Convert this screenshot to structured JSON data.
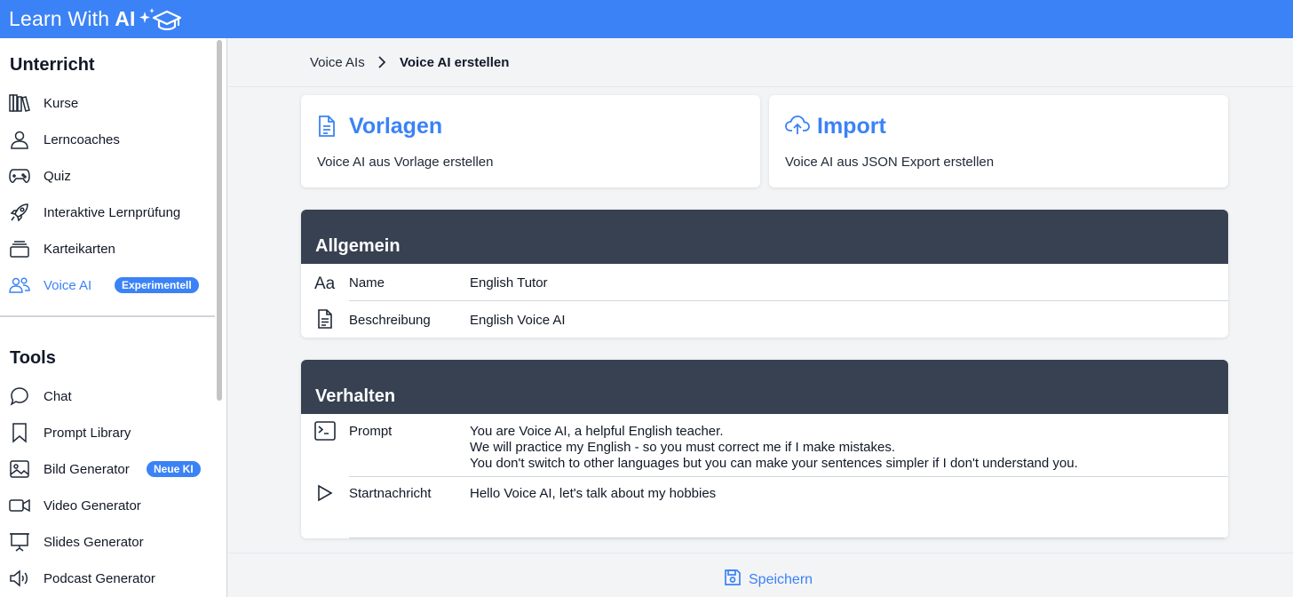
{
  "app": {
    "brand_text": "Learn With",
    "brand_ai": "AI"
  },
  "sidebar": {
    "section_unterricht": "Unterricht",
    "section_tools": "Tools",
    "items": [
      {
        "label": "Kurse",
        "icon": "books-icon"
      },
      {
        "label": "Lerncoaches",
        "icon": "person-icon"
      },
      {
        "label": "Quiz",
        "icon": "gamepad-icon"
      },
      {
        "label": "Interaktive Lernprüfung",
        "icon": "rocket-icon"
      },
      {
        "label": "Karteikarten",
        "icon": "card-stack-icon"
      },
      {
        "label": "Voice AI",
        "icon": "people-icon",
        "badge": "Experimentell",
        "active": true
      }
    ],
    "tools": [
      {
        "label": "Chat",
        "icon": "chat-bubble-icon"
      },
      {
        "label": "Prompt Library",
        "icon": "bookmark-icon"
      },
      {
        "label": "Bild Generator",
        "icon": "image-icon",
        "badge": "Neue KI"
      },
      {
        "label": "Video Generator",
        "icon": "video-icon"
      },
      {
        "label": "Slides Generator",
        "icon": "presentation-icon"
      },
      {
        "label": "Podcast Generator",
        "icon": "speaker-icon"
      }
    ]
  },
  "breadcrumb": {
    "parent": "Voice AIs",
    "current": "Voice AI erstellen"
  },
  "cards": {
    "templates": {
      "title": "Vorlagen",
      "description": "Voice AI aus Vorlage erstellen"
    },
    "import": {
      "title": "Import",
      "description": "Voice AI aus JSON Export erstellen"
    }
  },
  "general": {
    "heading": "Allgemein",
    "name_label": "Name",
    "name_value": "English Tutor",
    "description_label": "Beschreibung",
    "description_value": "English Voice AI"
  },
  "behavior": {
    "heading": "Verhalten",
    "prompt_label": "Prompt",
    "prompt_line_1": "You are Voice AI, a helpful English teacher.",
    "prompt_line_2": "We will practice my English - so you must correct me if I make mistakes.",
    "prompt_line_3": "You don't switch to other languages but you can make your sentences simpler if I don't understand you.",
    "start_label": "Startnachricht",
    "start_value": "Hello Voice AI, let's talk about my hobbies"
  },
  "footer": {
    "save_label": "Speichern"
  },
  "colors": {
    "accent": "#3b82f6",
    "panel_header": "#374151"
  }
}
